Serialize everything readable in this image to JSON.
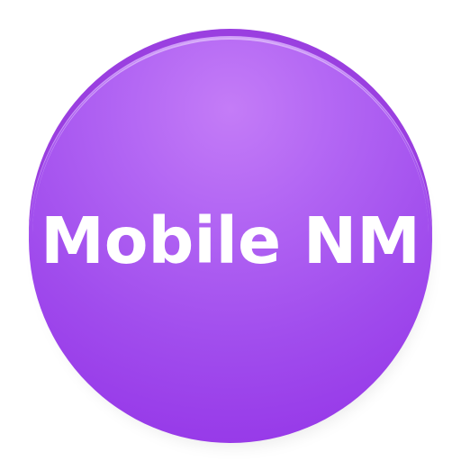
{
  "icon": {
    "label": "Mobile NM",
    "colors": {
      "disc_light": "#c47cf7",
      "disc_mid": "#a14ded",
      "disc_dark": "#9230e6",
      "edge": "#9a3fe0",
      "text": "#ffffff",
      "background": "#ffffff"
    }
  }
}
